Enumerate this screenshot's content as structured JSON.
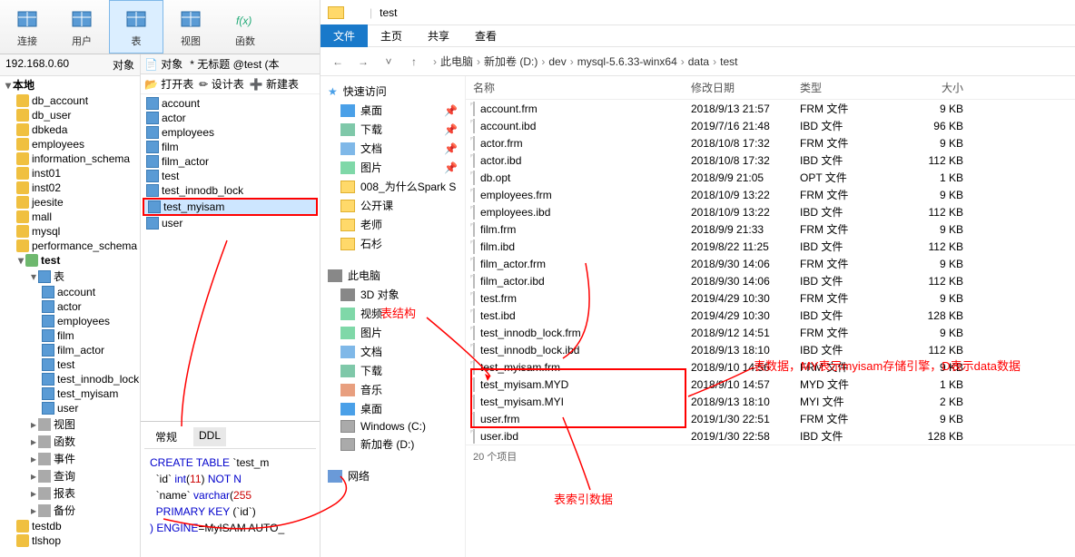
{
  "navicat": {
    "toolbar": [
      {
        "label": "连接",
        "name": "connect-tool"
      },
      {
        "label": "用户",
        "name": "user-tool"
      },
      {
        "label": "表",
        "name": "table-tool",
        "active": true
      },
      {
        "label": "视图",
        "name": "view-tool"
      },
      {
        "label": "函数",
        "name": "function-tool",
        "fx": true
      }
    ],
    "tree": {
      "header_left": "192.168.0.60",
      "header_right": "对象",
      "root": "本地",
      "dbs": [
        "db_account",
        "db_user",
        "dbkeda",
        "employees",
        "information_schema",
        "inst01",
        "inst02",
        "jeesite",
        "mall",
        "mysql",
        "performance_schema"
      ],
      "active_db": "test",
      "active_db_label": "表",
      "tables_under": [
        "account",
        "actor",
        "employees",
        "film",
        "film_actor",
        "test",
        "test_innodb_lock",
        "test_myisam",
        "user"
      ],
      "rest_nodes": [
        {
          "icon": "view",
          "label": "视图"
        },
        {
          "icon": "fx",
          "label": "函数"
        },
        {
          "icon": "event",
          "label": "事件"
        },
        {
          "icon": "query",
          "label": "查询"
        },
        {
          "icon": "report",
          "label": "报表"
        },
        {
          "icon": "backup",
          "label": "备份"
        }
      ],
      "extra_dbs": [
        "testdb",
        "tlshop"
      ]
    },
    "obj_tab_untitled": "* 无标题 @test (本",
    "obj_toolbar": {
      "open": "打开表",
      "design": "设计表",
      "new": "新建表"
    },
    "obj_list": [
      "account",
      "actor",
      "employees",
      "film",
      "film_actor",
      "test",
      "test_innodb_lock",
      "test_myisam",
      "user"
    ],
    "obj_selected": "test_myisam",
    "sql_tabs": {
      "general": "常规",
      "ddl": "DDL"
    },
    "sql_lines": {
      "l1a": "CREATE TABLE",
      "l1b": " `test_m",
      "l2a": "  `id` ",
      "l2b": "int",
      "l2c": "(",
      "l2d": "11",
      "l2e": ") ",
      "l2f": "NOT N",
      "l3a": "  `name` ",
      "l3b": "varchar",
      "l3c": "(",
      "l3d": "255",
      "l4a": "  PRIMARY KEY",
      "l4b": " (`id`)",
      "l5a": ") ENGINE",
      "l5b": "=MyISAM AUTO_"
    }
  },
  "explorer": {
    "title_path": "test",
    "ribbon": {
      "file": "文件",
      "home": "主页",
      "share": "共享",
      "view": "查看"
    },
    "breadcrumbs": [
      "此电脑",
      "新加卷 (D:)",
      "dev",
      "mysql-5.6.33-winx64",
      "data",
      "test"
    ],
    "nav": {
      "quick": "快速访问",
      "items1": [
        {
          "label": "桌面",
          "ico": "ico-desktop",
          "pin": true
        },
        {
          "label": "下载",
          "ico": "ico-download",
          "pin": true
        },
        {
          "label": "文档",
          "ico": "ico-doc",
          "pin": true
        },
        {
          "label": "图片",
          "ico": "ico-pic",
          "pin": true
        },
        {
          "label": "008_为什么Spark S",
          "ico": "ico-folder-y"
        },
        {
          "label": "公开课",
          "ico": "ico-folder-y"
        },
        {
          "label": "老师",
          "ico": "ico-folder-y"
        },
        {
          "label": "石杉",
          "ico": "ico-folder-y"
        }
      ],
      "this_pc": "此电脑",
      "items2": [
        {
          "label": "3D 对象",
          "ico": "ico-pc"
        },
        {
          "label": "视频",
          "ico": "ico-pic"
        },
        {
          "label": "图片",
          "ico": "ico-pic"
        },
        {
          "label": "文档",
          "ico": "ico-doc"
        },
        {
          "label": "下载",
          "ico": "ico-download"
        },
        {
          "label": "音乐",
          "ico": "ico-music"
        },
        {
          "label": "桌面",
          "ico": "ico-desktop"
        },
        {
          "label": "Windows (C:)",
          "ico": "ico-drive"
        },
        {
          "label": "新加卷 (D:)",
          "ico": "ico-drive"
        }
      ],
      "network": "网络"
    },
    "columns": {
      "name": "名称",
      "date": "修改日期",
      "type": "类型",
      "size": "大小"
    },
    "files": [
      {
        "name": "account.frm",
        "date": "2018/9/13 21:57",
        "type": "FRM 文件",
        "size": "9 KB"
      },
      {
        "name": "account.ibd",
        "date": "2019/7/16 21:48",
        "type": "IBD 文件",
        "size": "96 KB"
      },
      {
        "name": "actor.frm",
        "date": "2018/10/8 17:32",
        "type": "FRM 文件",
        "size": "9 KB"
      },
      {
        "name": "actor.ibd",
        "date": "2018/10/8 17:32",
        "type": "IBD 文件",
        "size": "112 KB"
      },
      {
        "name": "db.opt",
        "date": "2018/9/9 21:05",
        "type": "OPT 文件",
        "size": "1 KB"
      },
      {
        "name": "employees.frm",
        "date": "2018/10/9 13:22",
        "type": "FRM 文件",
        "size": "9 KB"
      },
      {
        "name": "employees.ibd",
        "date": "2018/10/9 13:22",
        "type": "IBD 文件",
        "size": "112 KB"
      },
      {
        "name": "film.frm",
        "date": "2018/9/9 21:33",
        "type": "FRM 文件",
        "size": "9 KB"
      },
      {
        "name": "film.ibd",
        "date": "2019/8/22 11:25",
        "type": "IBD 文件",
        "size": "112 KB"
      },
      {
        "name": "film_actor.frm",
        "date": "2018/9/30 14:06",
        "type": "FRM 文件",
        "size": "9 KB"
      },
      {
        "name": "film_actor.ibd",
        "date": "2018/9/30 14:06",
        "type": "IBD 文件",
        "size": "112 KB"
      },
      {
        "name": "test.frm",
        "date": "2019/4/29 10:30",
        "type": "FRM 文件",
        "size": "9 KB"
      },
      {
        "name": "test.ibd",
        "date": "2019/4/29 10:30",
        "type": "IBD 文件",
        "size": "128 KB"
      },
      {
        "name": "test_innodb_lock.frm",
        "date": "2018/9/12 14:51",
        "type": "FRM 文件",
        "size": "9 KB"
      },
      {
        "name": "test_innodb_lock.ibd",
        "date": "2018/9/13 18:10",
        "type": "IBD 文件",
        "size": "112 KB"
      },
      {
        "name": "test_myisam.frm",
        "date": "2018/9/10 14:56",
        "type": "FRM 文件",
        "size": "9 KB"
      },
      {
        "name": "test_myisam.MYD",
        "date": "2018/9/10 14:57",
        "type": "MYD 文件",
        "size": "1 KB"
      },
      {
        "name": "test_myisam.MYI",
        "date": "2018/9/13 18:10",
        "type": "MYI 文件",
        "size": "2 KB"
      },
      {
        "name": "user.frm",
        "date": "2019/1/30 22:51",
        "type": "FRM 文件",
        "size": "9 KB"
      },
      {
        "name": "user.ibd",
        "date": "2019/1/30 22:58",
        "type": "IBD 文件",
        "size": "128 KB"
      }
    ],
    "status": "20 个项目"
  },
  "annotations": {
    "struct": "表结构",
    "data": "表数据，MY表示myisam存储引擎，D表示data数据",
    "index": "表索引数据"
  }
}
